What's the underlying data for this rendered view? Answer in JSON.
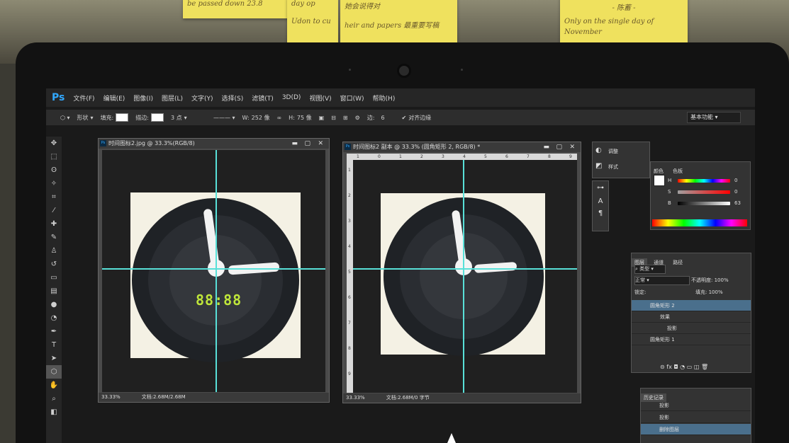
{
  "notes": [
    {
      "text": "be passed down 23.8"
    },
    {
      "text": "day op"
    },
    {
      "text": "Udon to cu"
    },
    {
      "text": "她会说得对"
    },
    {
      "text": "heir and papers 最重要写稿"
    },
    {
      "text": "- 陈蓄 -"
    },
    {
      "text": "Only on the single day of November"
    }
  ],
  "app": {
    "logo": "Ps",
    "menu": [
      "文件(F)",
      "编辑(E)",
      "图像(I)",
      "图层(L)",
      "文字(Y)",
      "选择(S)",
      "滤镜(T)",
      "3D(D)",
      "视图(V)",
      "窗口(W)",
      "帮助(H)"
    ],
    "options": {
      "mode": "形状",
      "fill_label": "填充:",
      "stroke_label": "描边:",
      "stroke_size": "3 点",
      "w_label": "W:",
      "w_value": "252 像",
      "h_label": "H:",
      "h_value": "75 像",
      "sides_label": "边:",
      "sides_value": "6",
      "align_label": "对齐边缘"
    },
    "workspace": "基本功能"
  },
  "documents": [
    {
      "title": "时间图标2.jpg @ 33.3%(RGB/8)",
      "zoom": "33.33%",
      "status": "文档:2.68M/2.68M",
      "lcd": "88:88"
    },
    {
      "title": "时间图标2 副本 @ 33.3% (圆角矩形 2, RGB/8) *",
      "zoom": "33.33%",
      "status": "文档:2.68M/0 字节"
    }
  ],
  "ruler_numbers": [
    "1",
    "0",
    "1",
    "2",
    "3",
    "4",
    "5",
    "6",
    "7",
    "8",
    "9"
  ],
  "vertical_ruler_numbers": [
    "1",
    "2",
    "3",
    "4",
    "5",
    "6",
    "7",
    "8",
    "9"
  ],
  "panels": {
    "mini": [
      "调整",
      "样式"
    ],
    "color": {
      "tabs": [
        "颜色",
        "色板"
      ],
      "h": {
        "label": "H",
        "value": "0"
      },
      "s": {
        "label": "S",
        "value": "0"
      },
      "b": {
        "label": "B",
        "value": "63"
      }
    },
    "layers": {
      "tabs": [
        "图层",
        "通道",
        "路径"
      ],
      "kind": "类型",
      "blend": "正常",
      "opacity_label": "不透明度:",
      "opacity": "100%",
      "lock_label": "锁定:",
      "fill_label": "填充:",
      "fill": "100%",
      "items": [
        "圆角矩形 2",
        "效果",
        "投影",
        "圆角矩形 1"
      ]
    },
    "history": {
      "tab": "历史记录",
      "items": [
        "投影",
        "投影",
        "删除图层"
      ]
    }
  }
}
